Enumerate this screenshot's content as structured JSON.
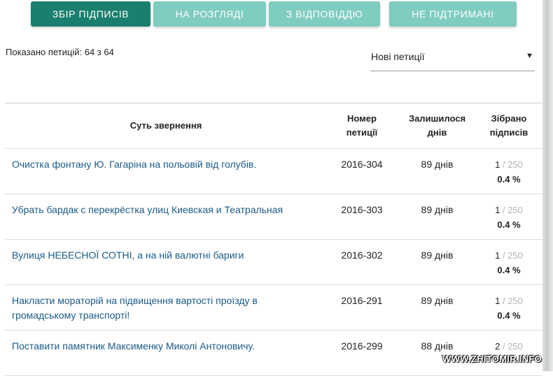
{
  "tabs": [
    {
      "label": "Збір підписів",
      "active": true
    },
    {
      "label": "На розгляді",
      "active": false
    },
    {
      "label": "З відповіддю",
      "active": false
    },
    {
      "label": "Не підтримані",
      "active": false
    }
  ],
  "shown_count": "Показано петицій: 64 з 64",
  "sort": {
    "selected": "Нові петиції",
    "arrow_icon": "triangle-down"
  },
  "table": {
    "headers": {
      "title": "Суть звернення",
      "number": "Номер петиції",
      "days": "Залишилося днів",
      "signatures": "Зібрано підписів"
    },
    "rows": [
      {
        "title": "Очистка фонтану Ю. Гагаріна на польовій від голубів.",
        "number": "2016-304",
        "days": "89 днів",
        "count": "1",
        "goal": "250",
        "percent": "0.4 %"
      },
      {
        "title": "Убрать бардак с перекрёстка улиц Киевская и Театральная",
        "number": "2016-303",
        "days": "89 днів",
        "count": "1",
        "goal": "250",
        "percent": "0.4 %"
      },
      {
        "title": "Вулиця НЕБЕСНОЇ СОТНІ, а на ній валютні бариги",
        "number": "2016-302",
        "days": "89 днів",
        "count": "1",
        "goal": "250",
        "percent": "0.4 %"
      },
      {
        "title": "Накласти мораторій на підвищення вартості проїзду в громадському транспорті!",
        "number": "2016-291",
        "days": "89 днів",
        "count": "1",
        "goal": "250",
        "percent": "0.4 %"
      },
      {
        "title": "Поставити памятник Максименку Миколі Антоновичу.",
        "number": "2016-299",
        "days": "88 днів",
        "count": "2",
        "goal": "250",
        "percent": ""
      }
    ]
  },
  "watermark": "WWW.ZHITOMIR.INFO",
  "colors": {
    "tab_active": "#1a7f6e",
    "tab_inactive": "#7fccc0",
    "link": "#1b5a85"
  }
}
